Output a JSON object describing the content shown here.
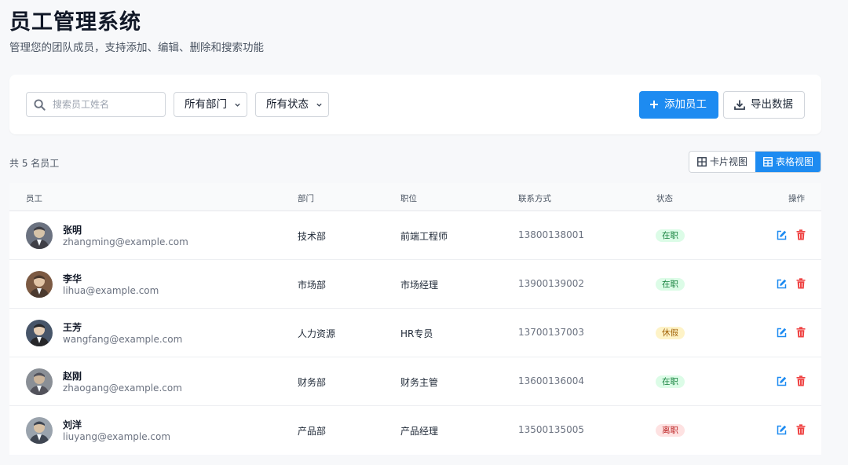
{
  "header": {
    "title": "员工管理系统",
    "subtitle": "管理您的团队成员，支持添加、编辑、删除和搜索功能"
  },
  "toolbar": {
    "search_placeholder": "搜索员工姓名",
    "search_value": "",
    "department_filter": "所有部门",
    "status_filter": "所有状态",
    "add_label": "添加员工",
    "export_label": "导出数据"
  },
  "summary": {
    "count_text": "共 5 名员工"
  },
  "view_toggle": {
    "card_label": "卡片视图",
    "table_label": "表格视图",
    "active": "table"
  },
  "table": {
    "headers": [
      "员工",
      "部门",
      "职位",
      "联系方式",
      "状态",
      "操作"
    ],
    "rows": [
      {
        "name": "张明",
        "email": "zhangming@example.com",
        "department": "技术部",
        "position": "前端工程师",
        "phone": "13800138001",
        "status": "在职",
        "status_color": "#dcfce7",
        "status_text_color": "#15803d",
        "avatar": "avatar-photo"
      },
      {
        "name": "李华",
        "email": "lihua@example.com",
        "department": "市场部",
        "position": "市场经理",
        "phone": "13900139002",
        "status": "在职",
        "status_color": "#dcfce7",
        "status_text_color": "#15803d",
        "avatar": "avatar-photo"
      },
      {
        "name": "王芳",
        "email": "wangfang@example.com",
        "department": "人力资源",
        "position": "HR专员",
        "phone": "13700137003",
        "status": "休假",
        "status_color": "#fef3c7",
        "status_text_color": "#a16207",
        "avatar": "avatar-photo"
      },
      {
        "name": "赵刚",
        "email": "zhaogang@example.com",
        "department": "财务部",
        "position": "财务主管",
        "phone": "13600136004",
        "status": "在职",
        "status_color": "#dcfce7",
        "status_text_color": "#15803d",
        "avatar": "avatar-photo"
      },
      {
        "name": "刘洋",
        "email": "liuyang@example.com",
        "department": "产品部",
        "position": "产品经理",
        "phone": "13500135005",
        "status": "离职",
        "status_color": "#fee2e2",
        "status_text_color": "#b91c1c",
        "avatar": "avatar-photo"
      }
    ]
  },
  "colors": {
    "accent": "#1d8bf1",
    "danger": "#ef4444",
    "background": "#f7f8fa"
  },
  "icons": {
    "search": "search-icon",
    "chevron": "chevron-down-icon",
    "add": "plus-icon",
    "export": "download-icon",
    "card_view": "grid-icon",
    "table_view": "table-icon",
    "edit": "edit-icon",
    "delete": "trash-icon"
  }
}
